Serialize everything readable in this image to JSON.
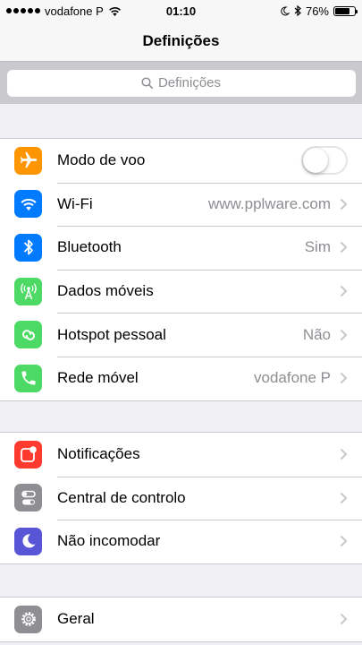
{
  "status_bar": {
    "carrier": "vodafone P",
    "time": "01:10",
    "battery": "76%",
    "battery_level": 0.76
  },
  "nav": {
    "title": "Definições"
  },
  "search": {
    "placeholder": "Definições"
  },
  "colors": {
    "airplane": "#ff9500",
    "wifi": "#007aff",
    "bluetooth": "#007aff",
    "cellular": "#4cd964",
    "hotspot": "#4cd964",
    "carrier": "#4cd964",
    "notifications": "#ff3b30",
    "control_center": "#8e8e93",
    "dnd": "#5856d6",
    "general": "#8e8e93"
  },
  "groups": [
    {
      "rows": [
        {
          "label": "Modo de voo",
          "icon": "airplane-icon",
          "toggle": false
        },
        {
          "label": "Wi-Fi",
          "value": "www.pplware.com",
          "icon": "wifi-icon"
        },
        {
          "label": "Bluetooth",
          "value": "Sim",
          "icon": "bluetooth-icon"
        },
        {
          "label": "Dados móveis",
          "icon": "cellular-icon"
        },
        {
          "label": "Hotspot pessoal",
          "value": "Não",
          "icon": "hotspot-icon"
        },
        {
          "label": "Rede móvel",
          "value": "vodafone P",
          "icon": "phone-icon"
        }
      ]
    },
    {
      "rows": [
        {
          "label": "Notificações",
          "icon": "notifications-icon"
        },
        {
          "label": "Central de controlo",
          "icon": "control-center-icon"
        },
        {
          "label": "Não incomodar",
          "icon": "moon-icon"
        }
      ]
    },
    {
      "rows": [
        {
          "label": "Geral",
          "icon": "gear-icon"
        }
      ]
    }
  ]
}
